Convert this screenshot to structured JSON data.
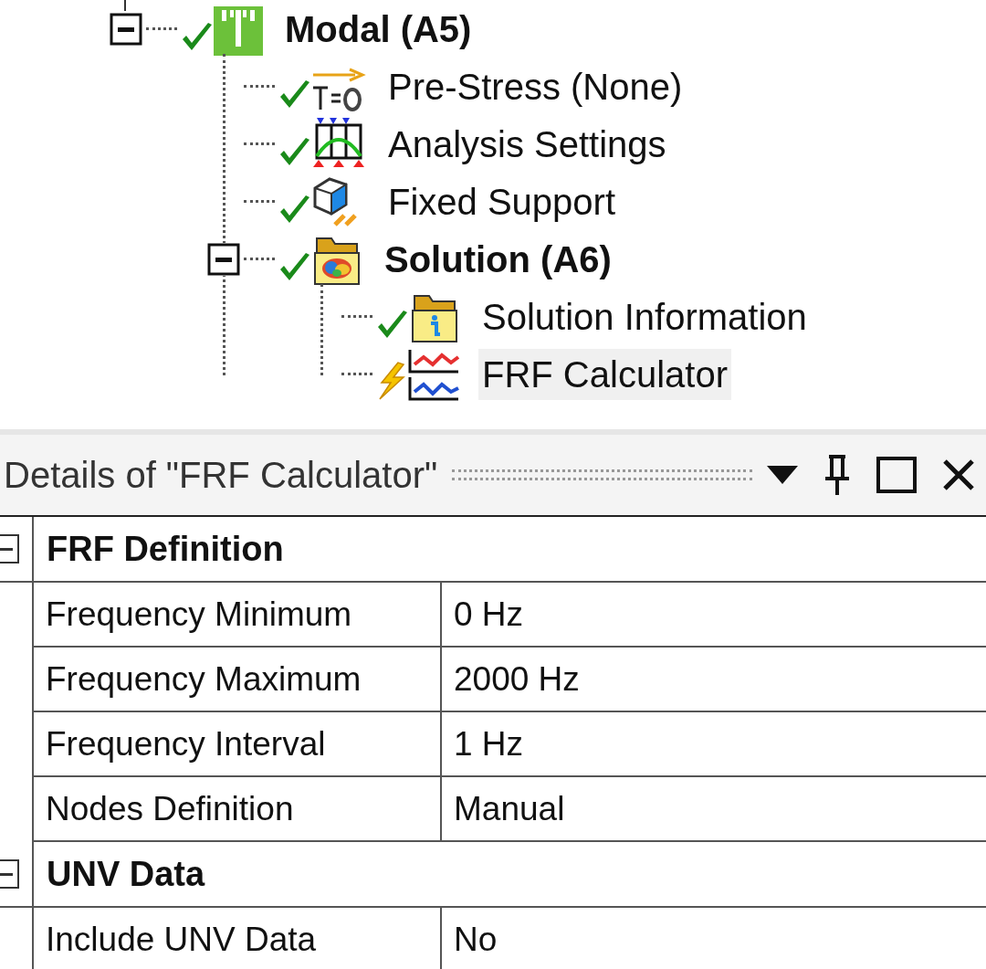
{
  "tree": {
    "label": "Modal (A5)",
    "kind": "modal",
    "done": true,
    "bold": true,
    "selected": false,
    "expanded": true,
    "children": [
      {
        "label": "Pre-Stress (None)",
        "kind": "prestress",
        "done": true,
        "bold": false,
        "selected": false
      },
      {
        "label": "Analysis Settings",
        "kind": "analysis",
        "done": true,
        "bold": false,
        "selected": false
      },
      {
        "label": "Fixed Support",
        "kind": "support",
        "done": true,
        "bold": false,
        "selected": false
      },
      {
        "label": "Solution (A6)",
        "kind": "solution",
        "done": true,
        "bold": true,
        "selected": false,
        "expanded": true,
        "children": [
          {
            "label": "Solution Information",
            "kind": "info",
            "done": true,
            "bold": false,
            "selected": false
          },
          {
            "label": "FRF Calculator",
            "kind": "frf",
            "done": false,
            "bold": false,
            "selected": true
          }
        ]
      }
    ]
  },
  "details": {
    "title": "Details of \"FRF Calculator\"",
    "sections": [
      {
        "title": "FRF Definition",
        "expanded": true,
        "rows": [
          {
            "label": "Frequency Minimum",
            "value": "0 Hz"
          },
          {
            "label": "Frequency Maximum",
            "value": "2000 Hz"
          },
          {
            "label": "Frequency Interval",
            "value": "1 Hz"
          },
          {
            "label": "Nodes Definition",
            "value": "Manual"
          }
        ]
      },
      {
        "title": "UNV Data",
        "expanded": true,
        "rows": [
          {
            "label": "Include UNV Data",
            "value": "No"
          }
        ]
      }
    ]
  }
}
